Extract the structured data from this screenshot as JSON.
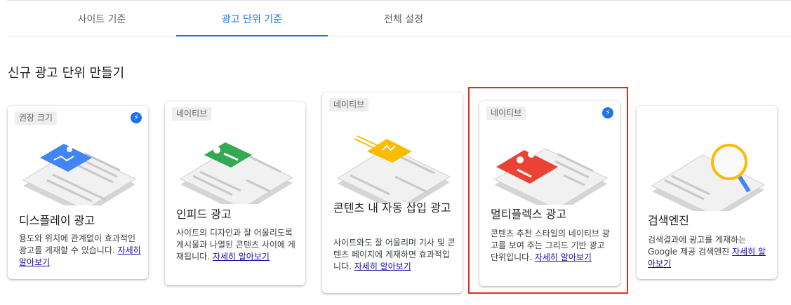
{
  "tabs": [
    {
      "label": "사이트 기준"
    },
    {
      "label": "광고 단위 기준"
    },
    {
      "label": "전체 설정"
    }
  ],
  "active_tab": "광고 단위 기준",
  "section_title": "신규 광고 단위 만들기",
  "cards": [
    {
      "badge": "권장 크기",
      "title": "디스플레이 광고",
      "desc": "용도와 위치에 관계없이 효과적인 광고를 게재할 수 있습니다.",
      "link": "자세히 알아보기",
      "lightning_icon": true,
      "illustration": "blue-image-ad-icon"
    },
    {
      "badge": "네이티브",
      "title": "인피드 광고",
      "desc": "사이트의 디자인과 잘 어울리도록 게시물과 나열된 콘텐츠 사이에 게재됩니다.",
      "link": "자세히 알아보기",
      "lightning_icon": false,
      "illustration": "green-infeed-ad-icon"
    },
    {
      "badge": "네이티브",
      "title": "콘텐츠 내 자동 삽입 광고",
      "desc": "사이트와도 잘 어울리며 기사 및 콘텐츠 페이지에 게재하면 효과적입니다.",
      "link": "자세히 알아보기",
      "lightning_icon": false,
      "illustration": "yellow-inarticle-ad-icon"
    },
    {
      "badge": "네이티브",
      "title": "멀티플렉스 광고",
      "desc": "콘텐츠 추천 스타일의 네이티브 광고를 보여 주는 그리드 기반 광고 단위입니다.",
      "link": "자세히 알아보기",
      "lightning_icon": true,
      "illustration": "red-multiplex-ad-icon"
    },
    {
      "badge": "",
      "title": "검색엔진",
      "desc": "검색결과에 광고를 게재하는 Google 제공 검색엔진",
      "link": "자세히 알아보기",
      "lightning_icon": false,
      "illustration": "magnifier-search-icon"
    }
  ],
  "colors": {
    "accent": "#1a73e8",
    "highlight": "#d93025",
    "blue": "#4285f4",
    "green": "#34a853",
    "yellow": "#fbbc04",
    "red": "#ea4335"
  },
  "selected_card": "멀티플렉스 광고"
}
